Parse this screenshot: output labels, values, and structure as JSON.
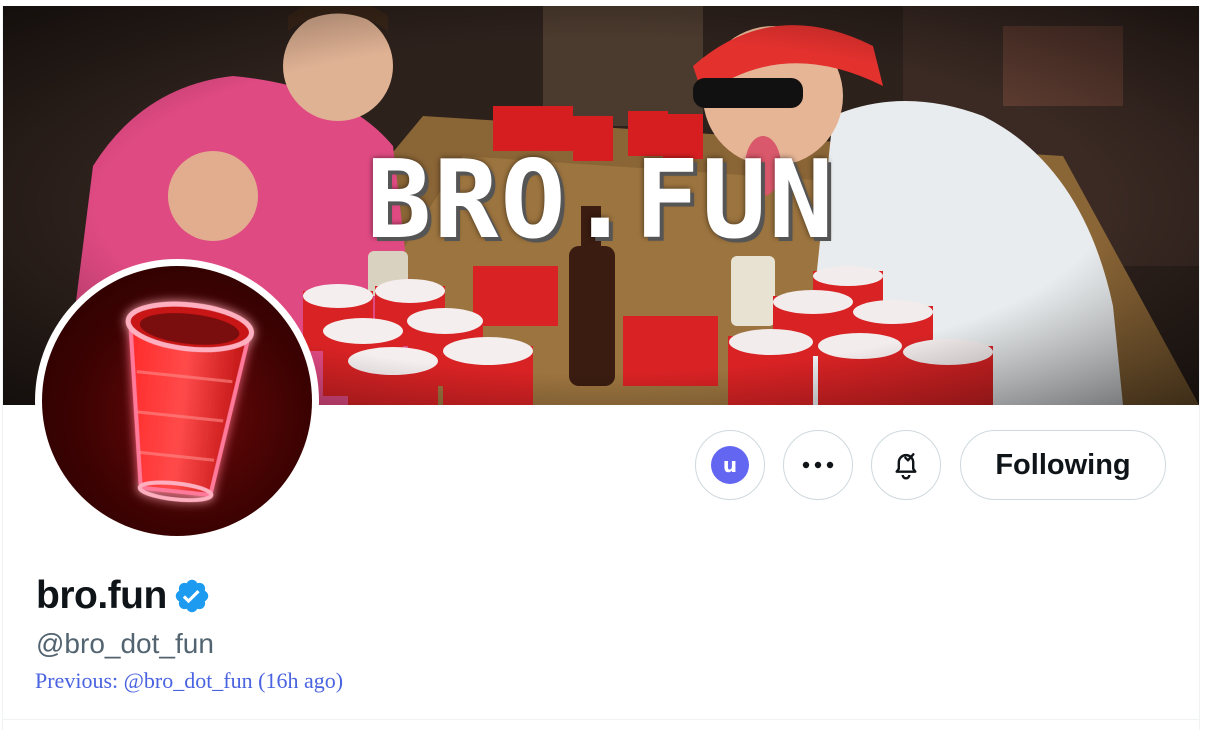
{
  "banner": {
    "title": "BRO.FUN",
    "image": "party-beer-pong-photo"
  },
  "avatar": {
    "image": "neon-red-cup"
  },
  "actions": {
    "user_badge_letter": "u",
    "more_icon": "ellipsis-icon",
    "notify_icon": "bell-check-icon",
    "following_label": "Following"
  },
  "profile": {
    "display_name": "bro.fun",
    "verified_icon": "verified-badge-icon",
    "verified_color": "#1d9bf0",
    "handle": "@bro_dot_fun",
    "previous_handle": "Previous: @bro_dot_fun (16h ago)"
  },
  "colors": {
    "accent_badge": "#6366f1",
    "previous_link": "#4a63e0",
    "border": "#cfd9de"
  }
}
